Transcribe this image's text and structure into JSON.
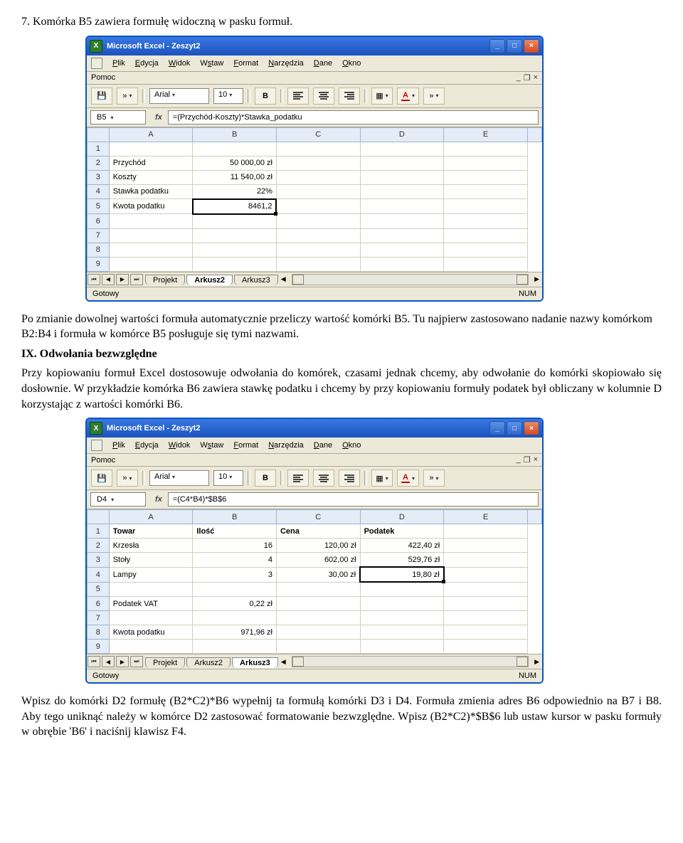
{
  "doc": {
    "p1": "7. Komórka B5 zawiera formułę widoczną w pasku formuł.",
    "p2": "Po zmianie dowolnej wartości formuła automatycznie przeliczy wartość komórki B5. Tu najpierw zastosowano nadanie nazwy komórkom B2:B4 i formuła w komórce B5 posługuje się tymi nazwami.",
    "h1": "IX. Odwołania bezwzględne",
    "p3": "Przy kopiowaniu formuł Excel dostosowuje odwołania do komórek, czasami jednak chcemy, aby odwołanie do komórki skopiowało się dosłownie. W przykładzie komórka B6 zawiera stawkę podatku i chcemy by przy kopiowaniu formuły podatek był obliczany w kolumnie D korzystając z wartości komórki B6.",
    "p4": "Wpisz do komórki D2 formułę (B2*C2)*B6 wypełnij ta formułą komórki D3 i D4. Formuła zmienia adres B6 odpowiednio na B7 i B8. Aby tego uniknąć należy w komórce D2 zastosować formatowanie bezwzględne. Wpisz (B2*C2)*$B$6 lub ustaw kursor w pasku formuły w obrębie 'B6' i naciśnij klawisz F4."
  },
  "win": {
    "title": "Microsoft Excel - Zeszyt2",
    "menu": [
      "Plik",
      "Edycja",
      "Widok",
      "Wstaw",
      "Format",
      "Narzędzia",
      "Dane",
      "Okno"
    ],
    "pomoc": "Pomoc",
    "font": "Arial",
    "size": "10",
    "status_left": "Gotowy",
    "status_right": "NUM"
  },
  "sheet1": {
    "cellref": "B5",
    "formula": "=(Przychód-Koszty)*Stawka_podatku",
    "cols": [
      "A",
      "B",
      "C",
      "D",
      "E"
    ],
    "rows": [
      {
        "n": "1",
        "A": "",
        "B": "",
        "C": "",
        "D": "",
        "E": ""
      },
      {
        "n": "2",
        "A": "Przychód",
        "B": "50 000,00 zł",
        "C": "",
        "D": "",
        "E": ""
      },
      {
        "n": "3",
        "A": "Koszty",
        "B": "11 540,00 zł",
        "C": "",
        "D": "",
        "E": ""
      },
      {
        "n": "4",
        "A": "Stawka podatku",
        "B": "22%",
        "C": "",
        "D": "",
        "E": ""
      },
      {
        "n": "5",
        "A": "Kwota podatku",
        "B": "8461,2",
        "sel": "B",
        "C": "",
        "D": "",
        "E": ""
      },
      {
        "n": "6",
        "A": "",
        "B": "",
        "C": "",
        "D": "",
        "E": ""
      },
      {
        "n": "7",
        "A": "",
        "B": "",
        "C": "",
        "D": "",
        "E": ""
      },
      {
        "n": "8",
        "A": "",
        "B": "",
        "C": "",
        "D": "",
        "E": ""
      },
      {
        "n": "9",
        "A": "",
        "B": "",
        "C": "",
        "D": "",
        "E": ""
      }
    ],
    "tabs": [
      "Projekt",
      "Arkusz2",
      "Arkusz3"
    ],
    "active_tab": 1
  },
  "sheet2": {
    "cellref": "D4",
    "formula": "=(C4*B4)*$B$6",
    "cols": [
      "A",
      "B",
      "C",
      "D",
      "E"
    ],
    "rows": [
      {
        "n": "1",
        "A": "Towar",
        "B": "Ilość",
        "C": "Cena",
        "D": "Podatek",
        "E": "",
        "header": true
      },
      {
        "n": "2",
        "A": "Krzesła",
        "B": "16",
        "C": "120,00 zł",
        "D": "422,40 zł",
        "E": ""
      },
      {
        "n": "3",
        "A": "Stoły",
        "B": "4",
        "C": "602,00 zł",
        "D": "529,76 zł",
        "E": ""
      },
      {
        "n": "4",
        "A": "Lampy",
        "B": "3",
        "C": "30,00 zł",
        "D": "19,80 zł",
        "sel": "D",
        "E": ""
      },
      {
        "n": "5",
        "A": "",
        "B": "",
        "C": "",
        "D": "",
        "E": ""
      },
      {
        "n": "6",
        "A": "Podatek VAT",
        "B": "0,22 zł",
        "C": "",
        "D": "",
        "E": ""
      },
      {
        "n": "7",
        "A": "",
        "B": "",
        "C": "",
        "D": "",
        "E": ""
      },
      {
        "n": "8",
        "A": "Kwota podatku",
        "B": "971,96 zł",
        "C": "",
        "D": "",
        "E": ""
      },
      {
        "n": "9",
        "A": "",
        "B": "",
        "C": "",
        "D": "",
        "E": ""
      }
    ],
    "tabs": [
      "Projekt",
      "Arkusz2",
      "Arkusz3"
    ],
    "active_tab": 2
  }
}
